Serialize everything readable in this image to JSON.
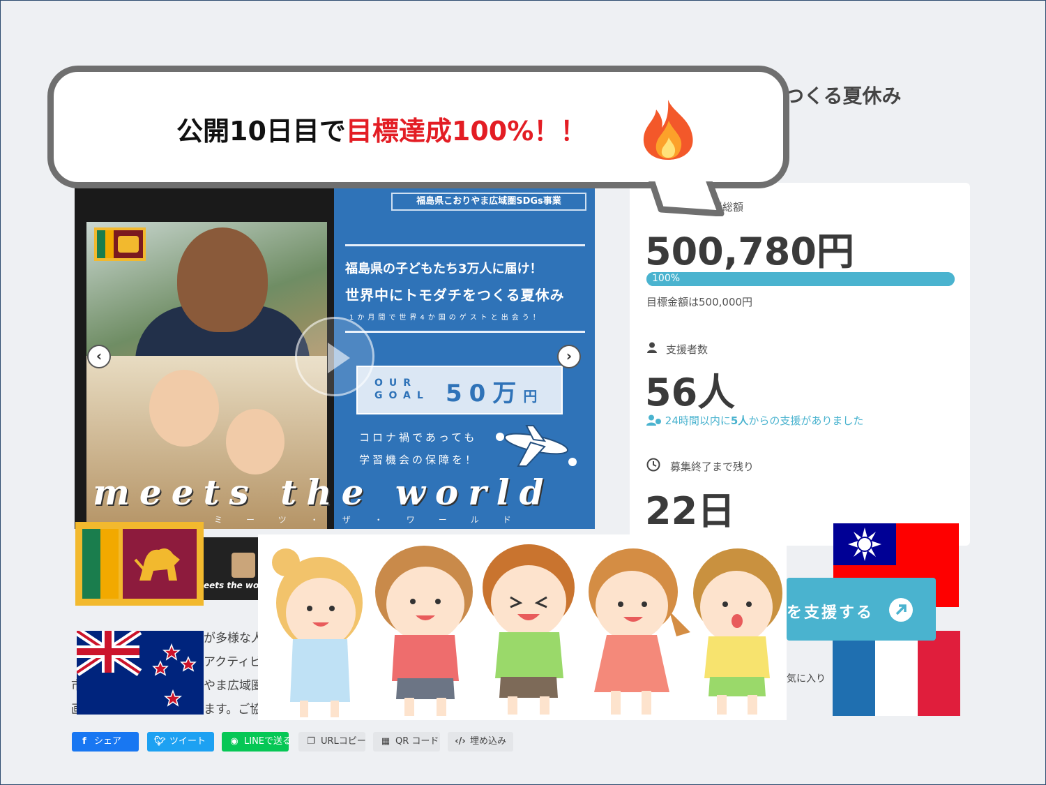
{
  "page": {
    "title_fragment": "つくる夏休み"
  },
  "bubble": {
    "text_black": "公開10日目で",
    "text_red": "目標達成100%！！",
    "icon": "fire-icon"
  },
  "video": {
    "poster_header": "福島県こおりやま広域圏SDGs事業",
    "line1": "福島県の子どもたち3万人に届け！",
    "line2": "世界中にトモダチをつくる夏休み",
    "line3": "1か月間で世界4か国のゲストと出会う！",
    "goal_en": "OUR GOAL",
    "goal_amount": "50万",
    "goal_unit": "円",
    "line4": "コロナ禍であっても",
    "line5": "学習機会の保障を！",
    "brand": "meets the world",
    "brand_kana": "ミーツ・ザ・ワールド",
    "prev_icon": "chevron-left-icon",
    "next_icon": "chevron-right-icon",
    "play_icon": "play-icon"
  },
  "card": {
    "total_label": "現在の支援総額",
    "total_amount": "500,780円",
    "progress_percent": 100,
    "progress_label": "100%",
    "goal_label": "目標金額は500,000円",
    "backers_label": "支援者数",
    "backers_count": "56人",
    "recent_prefix": "24時間以内に",
    "recent_count": "5人",
    "recent_suffix": "からの支援がありました",
    "remaining_label": "募集終了まで残り",
    "remaining_days": "22日"
  },
  "thumb": {
    "text": "eets the wor"
  },
  "description": {
    "line1": "が多様な人",
    "line2": "アクティビ",
    "line3": "やま広域圏",
    "line4": "ます。ご協",
    "left1": "市",
    "left2": "画"
  },
  "support": {
    "button_label": "を支援する",
    "favorite_label": "気に入り"
  },
  "share": {
    "facebook": "シェア",
    "twitter": "ツイート",
    "line": "LINEで送る",
    "url_copy": "URLコピー",
    "qr": "QR コード",
    "embed": "埋め込み"
  },
  "colors": {
    "accent": "#4ab3cf",
    "highlight_red": "#e31d24",
    "poster_blue": "#2f73b8",
    "facebook": "#1877f2",
    "twitter": "#1da1f2",
    "line": "#06c755"
  }
}
